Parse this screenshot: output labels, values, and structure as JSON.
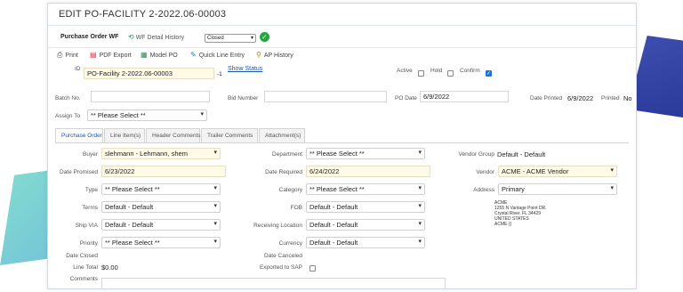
{
  "page": {
    "title": "EDIT PO-FACILITY 2-2022.06-00003"
  },
  "workflow": {
    "label": "Purchase Order WF",
    "history_link": "WF Detail History",
    "status_value": "Closed"
  },
  "toolbar": {
    "print": "Print",
    "pdf_export": "PDF Export",
    "model_po": "Model PO",
    "quick_line_entry": "Quick Line Entry",
    "ap_history": "AP History"
  },
  "header": {
    "id_label": "ID",
    "id_value": "PO-Facility 2-2022.06-00003",
    "id_suffix": "-1",
    "show_status": "Show Status",
    "active_label": "Active",
    "hold_label": "Hold",
    "confirm_label": "Confirm",
    "active_checked": false,
    "hold_checked": false,
    "confirm_checked": true,
    "batch_label": "Batch No.",
    "batch_value": "",
    "bid_label": "Bid Number",
    "bid_value": "",
    "po_date_label": "PO Date",
    "po_date_value": "6/9/2022",
    "date_printed_label": "Date Printed",
    "date_printed_value": "6/9/2022",
    "printed_label": "Printed",
    "printed_value": "No",
    "assign_label": "Assign To",
    "assign_value": "** Please Select **"
  },
  "tabs": [
    {
      "label": "Purchase Order",
      "active": true
    },
    {
      "label": "Line Item(s)",
      "active": false
    },
    {
      "label": "Header Comments",
      "active": false
    },
    {
      "label": "Trailer Comments",
      "active": false
    },
    {
      "label": "Attachment(s)",
      "active": false
    }
  ],
  "form": {
    "buyer_label": "Buyer",
    "buyer_value": "slehmann - Lehmann, shem",
    "date_promised_label": "Date Promised",
    "date_promised_value": "6/23/2022",
    "type_label": "Type",
    "type_value": "** Please Select **",
    "terms_label": "Terms",
    "terms_value": "Default - Default",
    "ship_via_label": "Ship VIA",
    "ship_via_value": "Default - Default",
    "priority_label": "Priority",
    "priority_value": "** Please Select **",
    "date_closed_label": "Date Closed",
    "date_closed_value": "",
    "line_total_label": "Line Total",
    "line_total_value": "$0.00",
    "comments_label": "Comments",
    "department_label": "Department",
    "department_value": "** Please Select **",
    "date_required_label": "Date Required",
    "date_required_value": "6/24/2022",
    "category_label": "Category",
    "category_value": "** Please Select **",
    "fob_label": "FOB",
    "fob_value": "Default - Default",
    "receiving_label": "Receiving Location",
    "receiving_value": "Default - Default",
    "currency_label": "Currency",
    "currency_value": "Default - Default",
    "date_canceled_label": "Date Canceled",
    "date_canceled_value": "",
    "exported_label": "Exported to SAP",
    "exported_checked": false,
    "vendor_group_label": "Vendor Group",
    "vendor_group_value": "Default - Default",
    "vendor_label": "Vendor",
    "vendor_value": "ACME - ACME Vendor",
    "address_label": "Address",
    "address_value": "Primary",
    "address_lines": [
      "ACME",
      "1255 N Vantage Point DR.",
      "Crystal River, FL 34429",
      "UNITED STATES",
      "ACME ()"
    ]
  },
  "colors": {
    "accent": "#1a53a8",
    "ok_green": "#22a83a",
    "highlight": "#fffbe6"
  }
}
